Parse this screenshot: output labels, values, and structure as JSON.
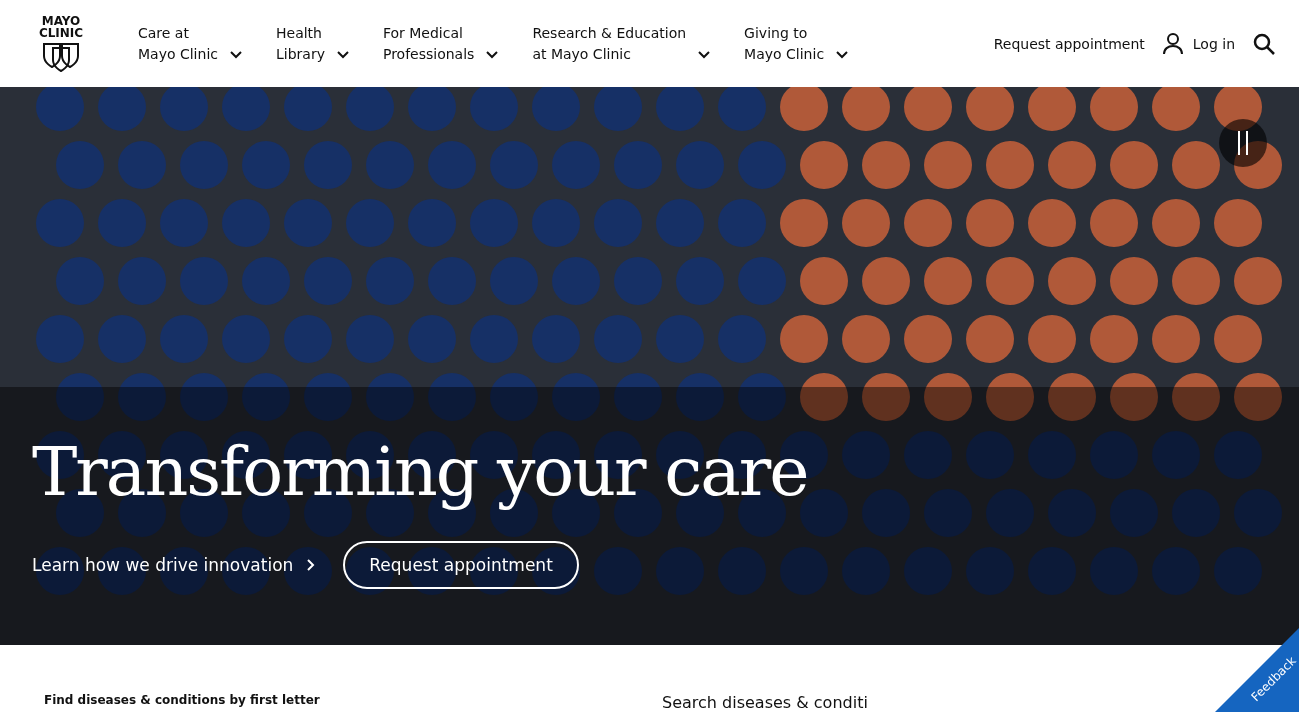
{
  "logo": {
    "line_1": "MAYO",
    "line_2": "CLINIC"
  },
  "nav": [
    {
      "line_1": "Care at",
      "line_2": "Mayo Clinic"
    },
    {
      "line_1": "Health",
      "line_2": "Library"
    },
    {
      "line_1": "For Medical",
      "line_2": "Professionals"
    },
    {
      "line_1": "Research & Education",
      "line_2": "at Mayo Clinic"
    },
    {
      "line_1": "Giving to",
      "line_2": "Mayo Clinic"
    }
  ],
  "header_actions": {
    "request_appointment": "Request appointment",
    "log_in": "Log in"
  },
  "hero": {
    "title": "Transforming your care",
    "link": "Learn how we drive innovation",
    "button": "Request appointment"
  },
  "below": {
    "find_heading": "Find diseases & conditions by first letter",
    "search_heading": "Search diseases & conditi"
  },
  "feedback": "Feedback"
}
